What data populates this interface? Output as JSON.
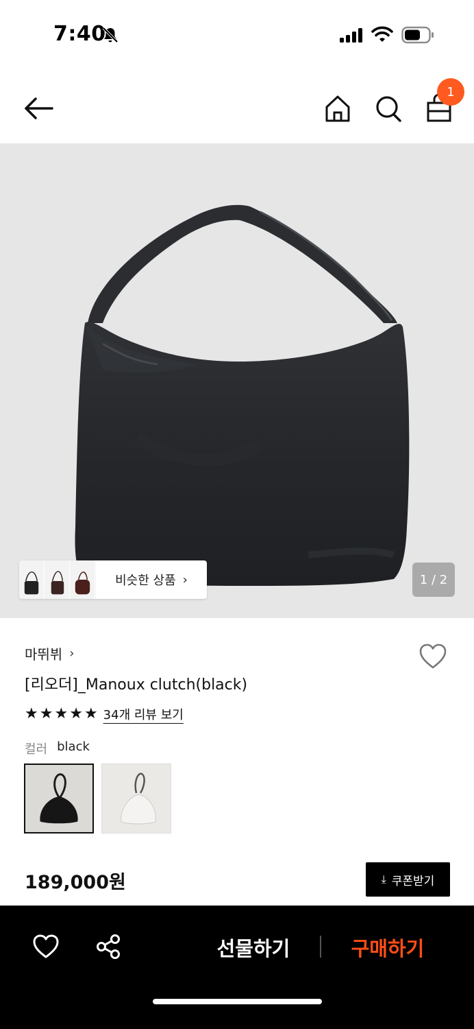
{
  "status_bar": {
    "time": "7:40",
    "icons": [
      "bell-slash-icon",
      "signal-icon",
      "wifi-icon",
      "battery-icon"
    ]
  },
  "nav": {
    "icons": [
      "arrow-left-icon",
      "home-icon",
      "search-icon",
      "shopping-bag-icon"
    ],
    "cart_count": "1",
    "badge_color": "#ff5a1f"
  },
  "gallery": {
    "similar_label": "비슷한 상품",
    "page_indicator": "1 / 2",
    "background": "#e6e6e6"
  },
  "product": {
    "brand": "마뛰뷔",
    "name": "[리오더]_Manoux clutch(black)",
    "rating_stars": 5,
    "review_link": "34개 리뷰 보기",
    "color_label": "컬러",
    "color_value": "black",
    "swatches": [
      "black",
      "white"
    ],
    "price": "189,000원",
    "coupon_label": "쿠폰받기"
  },
  "bottom_bar": {
    "gift_label": "선물하기",
    "buy_label": "구매하기",
    "buy_color": "#ff4e16",
    "icons": [
      "heart-icon",
      "share-icon"
    ]
  }
}
